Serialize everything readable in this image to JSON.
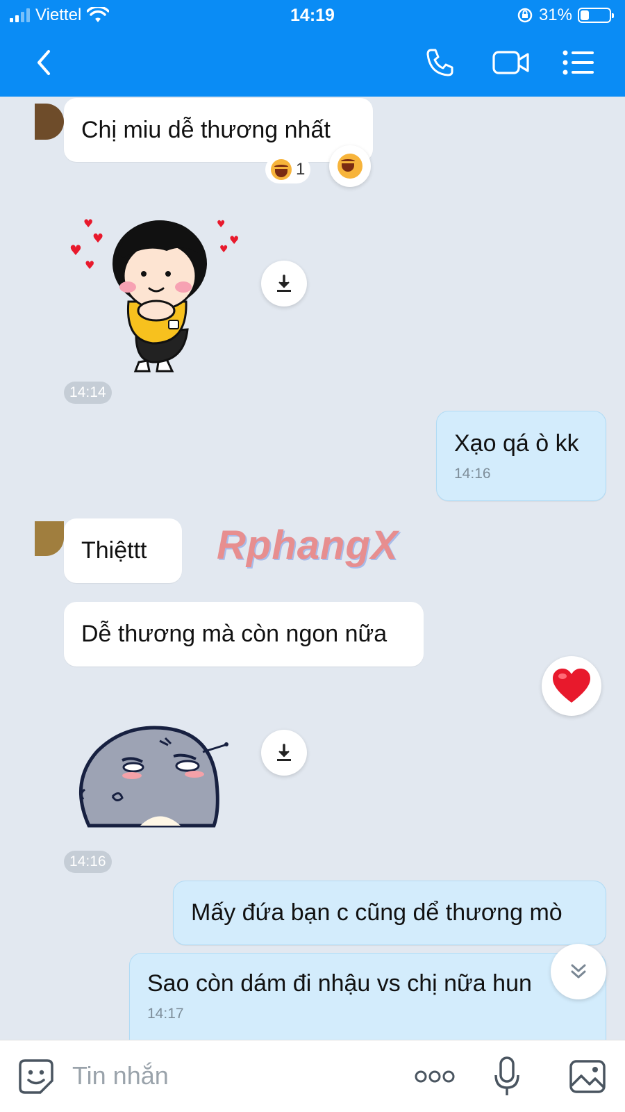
{
  "status": {
    "carrier": "Viettel",
    "time": "14:19",
    "battery": "31%",
    "battery_level": 0.31
  },
  "nav": {
    "back_icon": "chevron-left-icon",
    "call_icon": "phone-icon",
    "video_icon": "video-icon",
    "menu_icon": "list-menu-icon"
  },
  "messages": {
    "m1": {
      "text": "Chị miu dễ thương nhất",
      "reaction_count": "1"
    },
    "sticker1_time": "14:14",
    "m2": {
      "text": "Xạo qá ò kk",
      "time": "14:16"
    },
    "m3": {
      "text": "Thiệttt"
    },
    "m4": {
      "text": "Dễ thương mà còn ngon nữa"
    },
    "sticker2_time": "14:16",
    "m5": {
      "text": "Mấy đứa bạn c cũng dể thương mò"
    },
    "m6": {
      "text": "Sao còn dám đi nhậu vs chị nữa hun",
      "time": "14:17"
    }
  },
  "watermark": "RphangX",
  "input": {
    "placeholder": "Tin nhắn"
  },
  "colors": {
    "header": "#0a8cf5",
    "chat_bg": "#e2e8f0",
    "outgoing": "#d3ecfc",
    "heart": "#e8192c"
  }
}
